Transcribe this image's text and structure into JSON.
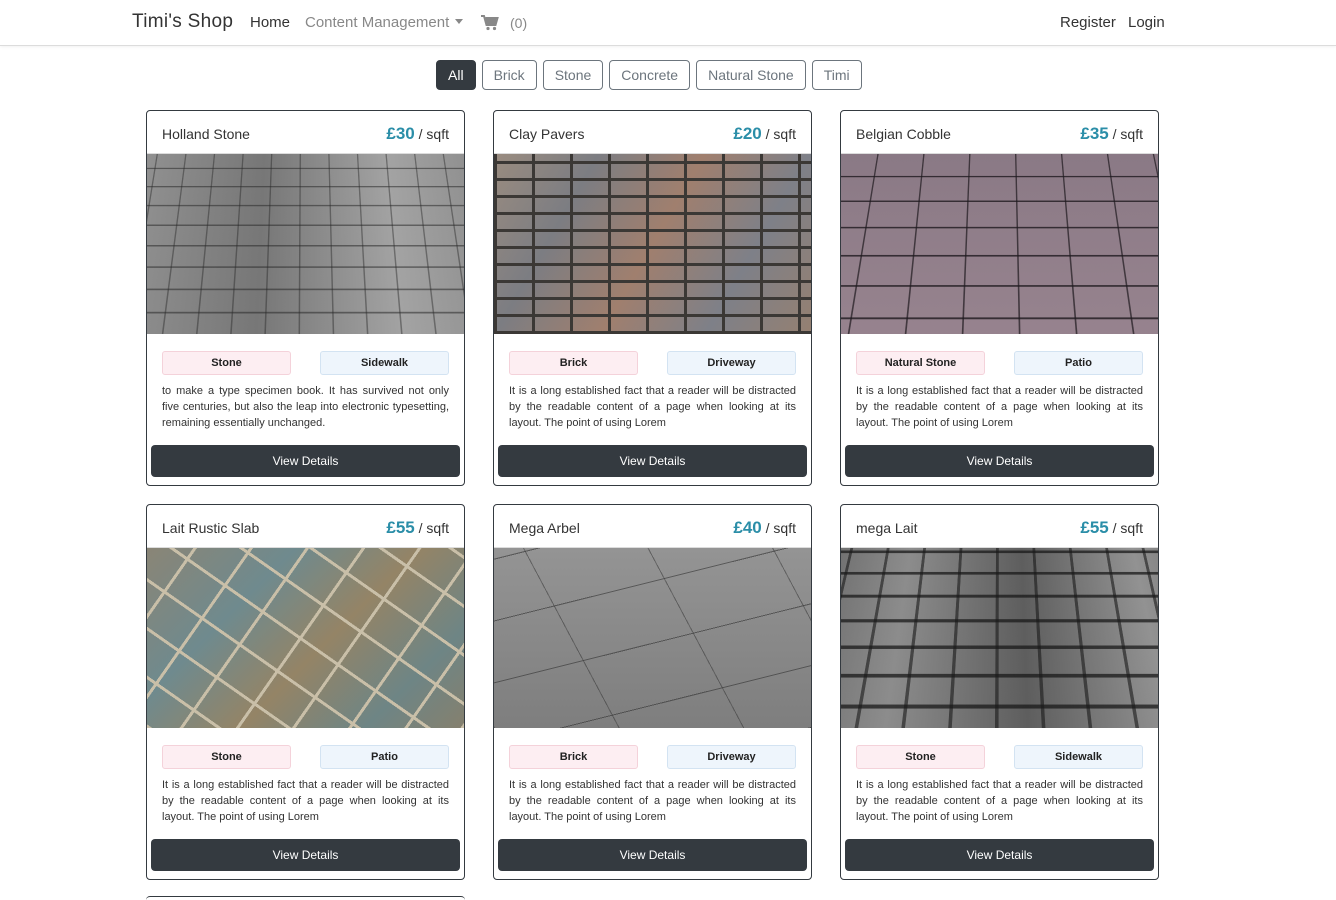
{
  "navbar": {
    "brand": "Timi's Shop",
    "home": "Home",
    "content_management": "Content Management",
    "cart_icon": "cart-icon",
    "cart_count": "(0)",
    "register": "Register",
    "login": "Login"
  },
  "filters": [
    "All",
    "Brick",
    "Stone",
    "Concrete",
    "Natural Stone",
    "Timi"
  ],
  "active_filter": "All",
  "price_color": "#2b8ea8",
  "products": [
    {
      "title": "Holland Stone",
      "price": "£30",
      "unit": "/ sqft",
      "tag_a": "Stone",
      "tag_b": "Sidewalk",
      "description": "to make a type specimen book. It has survived not only five centuries, but also the leap into electronic typesetting, remaining essentially unchanged.",
      "button": "View Details"
    },
    {
      "title": "Clay Pavers",
      "price": "£20",
      "unit": "/ sqft",
      "tag_a": "Brick",
      "tag_b": "Driveway",
      "description": "It is a long established fact that a reader will be distracted by the readable content of a page when looking at its layout. The point of using Lorem",
      "button": "View Details"
    },
    {
      "title": "Belgian Cobble",
      "price": "£35",
      "unit": "/ sqft",
      "tag_a": "Natural Stone",
      "tag_b": "Patio",
      "description": "It is a long established fact that a reader will be distracted by the readable content of a page when looking at its layout. The point of using Lorem",
      "button": "View Details"
    },
    {
      "title": "Lait Rustic Slab",
      "price": "£55",
      "unit": "/ sqft",
      "tag_a": "Stone",
      "tag_b": "Patio",
      "description": "It is a long established fact that a reader will be distracted by the readable content of a page when looking at its layout. The point of using Lorem",
      "button": "View Details"
    },
    {
      "title": "Mega Arbel",
      "price": "£40",
      "unit": "/ sqft",
      "tag_a": "Brick",
      "tag_b": "Driveway",
      "description": "It is a long established fact that a reader will be distracted by the readable content of a page when looking at its layout. The point of using Lorem",
      "button": "View Details"
    },
    {
      "title": "mega Lait",
      "price": "£55",
      "unit": "/ sqft",
      "tag_a": "Stone",
      "tag_b": "Sidewalk",
      "description": "It is a long established fact that a reader will be distracted by the readable content of a page when looking at its layout. The point of using Lorem",
      "button": "View Details"
    }
  ]
}
